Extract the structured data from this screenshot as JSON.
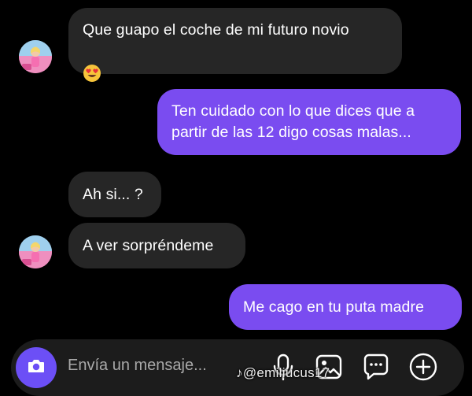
{
  "messages": [
    {
      "direction": "incoming",
      "text": "Que guapo el coche de mi futuro novio",
      "emoji": "heart-eyes-emoji"
    },
    {
      "direction": "outgoing",
      "text": "Ten cuidado con lo que dices que a\npartir de las 12 digo cosas malas..."
    },
    {
      "direction": "incoming",
      "text": "Ah si... ?"
    },
    {
      "direction": "incoming",
      "text": "A ver sorpréndeme"
    },
    {
      "direction": "outgoing",
      "text": "Me cago en tu puta madre"
    }
  ],
  "composer": {
    "placeholder": "Envía un mensaje...",
    "icons": [
      "camera-icon",
      "microphone-icon",
      "gallery-icon",
      "sticker-icon",
      "add-icon"
    ]
  },
  "watermark": "@emiliucus17",
  "colors": {
    "background": "#000000",
    "incoming_bubble": "#262626",
    "outgoing_bubble": "#7a4cf0",
    "camera_button": "#6c4ff6"
  }
}
